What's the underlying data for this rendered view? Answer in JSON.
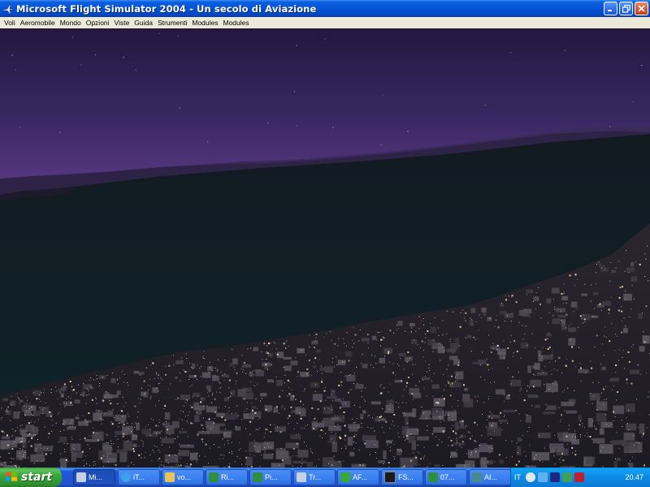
{
  "window": {
    "title": "Microsoft Flight Simulator 2004 - Un secolo di Aviazione",
    "icon": "plane-icon",
    "controls": [
      "minimize-icon",
      "maximize-icon",
      "close-icon"
    ]
  },
  "menu": {
    "items": [
      "Voli",
      "Aeromobile",
      "Mondo",
      "Opzioni",
      "Viste",
      "Guida",
      "Strumenti",
      "Modules",
      "Modules"
    ]
  },
  "scene": {
    "description_colors": {
      "sky_top": "#2c1c4a",
      "sky_horizon": "#5a3a85",
      "sea": "#101e24",
      "city_light": "#e8c890"
    }
  },
  "taskbar": {
    "start_label": "start",
    "tasks": [
      {
        "label": "Mi...",
        "icon": "plane-icon",
        "active": true
      },
      {
        "label": "iT...",
        "icon": "browser-icon",
        "active": false
      },
      {
        "label": "vo...",
        "icon": "folder-icon",
        "active": false
      },
      {
        "label": "Ri...",
        "icon": "spreadsheet-icon",
        "active": false
      },
      {
        "label": "Pi...",
        "icon": "spreadsheet-icon",
        "active": false
      },
      {
        "label": "Tr...",
        "icon": "plane-icon",
        "active": false
      },
      {
        "label": "AF...",
        "icon": "puzzle-icon",
        "active": false
      },
      {
        "label": "FS...",
        "icon": "terminal-icon",
        "active": false
      },
      {
        "label": "07...",
        "icon": "spreadsheet-icon",
        "active": false
      },
      {
        "label": "AI...",
        "icon": "app-icon",
        "active": false
      }
    ],
    "tray": {
      "language": "IT",
      "clock": "20.47",
      "icons": [
        "speaker-icon",
        "network-icon",
        "media-icon",
        "security-icon",
        "ati-icon"
      ]
    }
  }
}
